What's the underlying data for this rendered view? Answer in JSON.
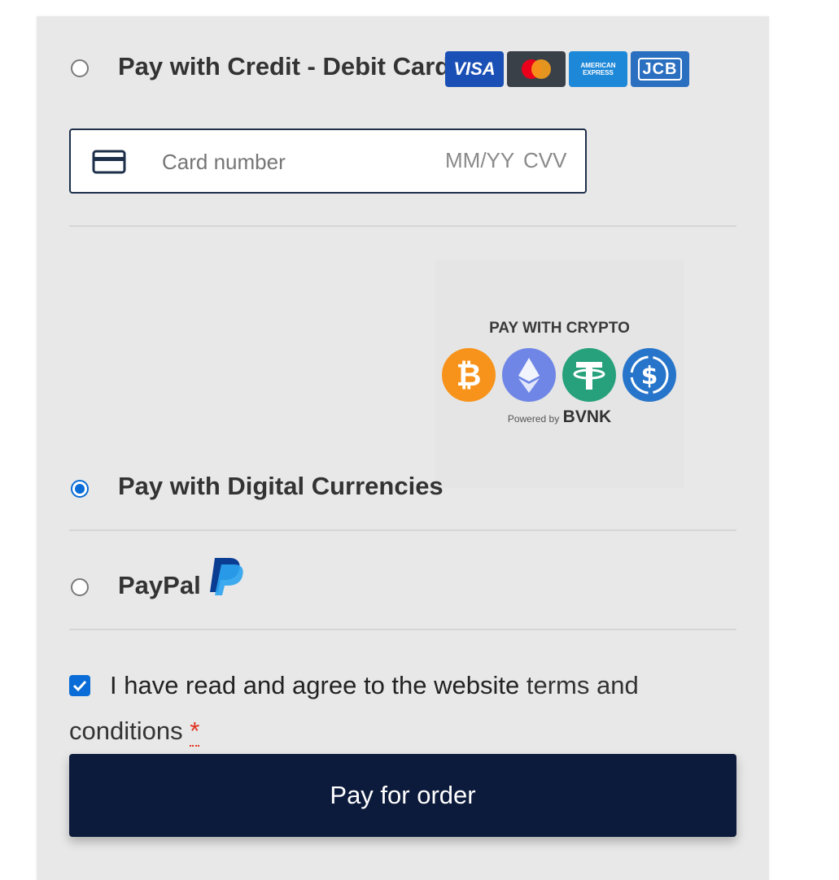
{
  "payment_methods": {
    "card": {
      "label": "Pay with Credit - Debit Card",
      "selected": false,
      "logos": [
        {
          "icon": "visa-logo",
          "text": "VISA",
          "color": "#1a4fb5"
        },
        {
          "icon": "mastercard-logo",
          "text": "",
          "color": "#3a4048"
        },
        {
          "icon": "amex-logo",
          "text": "AMERICAN EXPRESS",
          "color": "#1e88d8"
        },
        {
          "icon": "jcb-logo",
          "text": "JCB",
          "color": "#2a6fc0"
        }
      ],
      "field": {
        "icon": "credit-card-icon",
        "card_number_placeholder": "Card number",
        "expiry_placeholder": "MM/YY",
        "cvv_placeholder": "CVV"
      }
    },
    "crypto": {
      "label": "Pay with Digital Currencies",
      "selected": true,
      "banner": {
        "heading": "PAY WITH CRYPTO",
        "coins": [
          {
            "icon": "bitcoin-icon",
            "color": "#f7931a"
          },
          {
            "icon": "ethereum-icon",
            "color": "#6f86e6"
          },
          {
            "icon": "tether-icon",
            "color": "#26a17b"
          },
          {
            "icon": "usdc-icon",
            "color": "#2775ca"
          }
        ],
        "powered_by": "Powered by",
        "provider": "BVNK"
      }
    },
    "paypal": {
      "label": "PayPal",
      "selected": false,
      "icon": "paypal-icon"
    }
  },
  "terms": {
    "checked": true,
    "text": "I have read and agree to the website ",
    "link_text": "terms and conditions",
    "required_marker": "*"
  },
  "pay_button": {
    "label": "Pay for order"
  },
  "colors": {
    "accent": "#0a6cd6",
    "button_bg": "#0c1a3b",
    "panel_bg": "#e8e8e8",
    "required": "#e0301e"
  }
}
